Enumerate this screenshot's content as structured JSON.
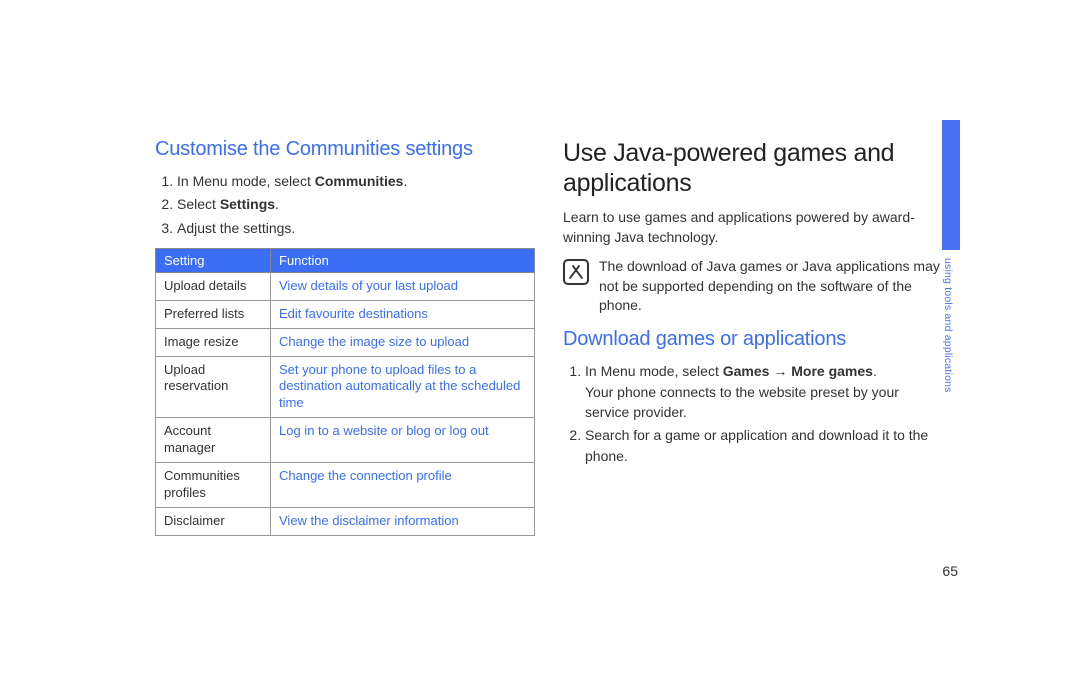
{
  "left": {
    "heading": "Customise the Communities settings",
    "steps": [
      {
        "pre": "In Menu mode, select ",
        "bold": "Communities",
        "post": "."
      },
      {
        "pre": "Select ",
        "bold": "Settings",
        "post": "."
      },
      {
        "pre": "Adjust the settings.",
        "bold": "",
        "post": ""
      }
    ],
    "table": {
      "h1": "Setting",
      "h2": "Function",
      "rows": [
        {
          "s": "Upload details",
          "f": "View details of your last upload"
        },
        {
          "s": "Preferred lists",
          "f": "Edit favourite destinations"
        },
        {
          "s": "Image resize",
          "f": "Change the image size to upload"
        },
        {
          "s": "Upload reservation",
          "f": "Set your phone to upload files to a destination automatically at the scheduled time"
        },
        {
          "s": "Account manager",
          "f": "Log in to a website or blog or log out"
        },
        {
          "s": "Communities profiles",
          "f": "Change the connection profile"
        },
        {
          "s": "Disclaimer",
          "f": "View the disclaimer information"
        }
      ]
    }
  },
  "right": {
    "title": "Use Java-powered games and applications",
    "intro": "Learn to use games and applications powered by award-winning Java technology.",
    "note": "The download of Java games or Java applications may not be supported depending on the software of the phone.",
    "subheading": "Download games or applications",
    "steps": [
      {
        "line_pre": "In Menu mode, select ",
        "line_bold1": "Games",
        "line_mid": " → ",
        "line_bold2": "More games",
        "line_post": ".",
        "sub": "Your phone connects to the website preset by your service provider."
      },
      {
        "line_pre": "Search for a game or application and download it to the phone.",
        "line_bold1": "",
        "line_mid": "",
        "line_bold2": "",
        "line_post": "",
        "sub": ""
      }
    ]
  },
  "sidetab": "using tools and applications",
  "page_number": "65"
}
